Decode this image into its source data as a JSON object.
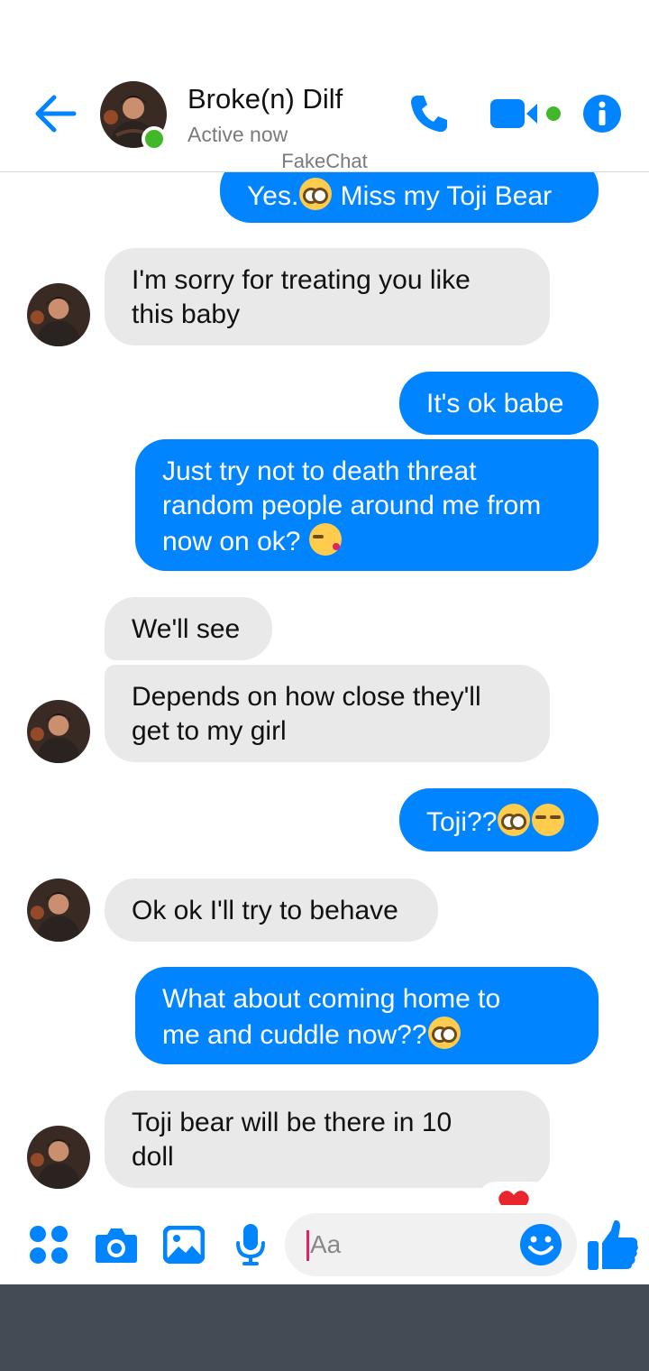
{
  "header": {
    "name": "Broke(n) Dilf",
    "status": "Active now",
    "watermark": "FakeChat"
  },
  "messages": [
    {
      "id": "m0",
      "from": "me",
      "text_before": "Yes.",
      "emoji": "flushed",
      "text_after": " Miss my Toji Bear"
    },
    {
      "id": "m1",
      "from": "them",
      "lines": [
        "I'm sorry for treating you like",
        "this baby"
      ]
    },
    {
      "id": "m2",
      "from": "me",
      "lines": [
        "It's ok babe"
      ]
    },
    {
      "id": "m3",
      "from": "me",
      "lines": [
        "Just try not to death threat",
        "random people around me from"
      ],
      "last_line": "now on ok? ",
      "emoji": "kiss"
    },
    {
      "id": "m4",
      "from": "them",
      "lines": [
        "We'll see"
      ]
    },
    {
      "id": "m5",
      "from": "them",
      "lines": [
        "Depends on how close they'll",
        "get to my girl"
      ]
    },
    {
      "id": "m6",
      "from": "me",
      "text": "Toji??",
      "emojis": [
        "flushed",
        "unamused"
      ]
    },
    {
      "id": "m7",
      "from": "them",
      "lines": [
        "Ok ok I'll try to behave"
      ]
    },
    {
      "id": "m8",
      "from": "me",
      "lines": [
        "What about coming home to"
      ],
      "last_line": "me and cuddle now??",
      "emoji": "flushed"
    },
    {
      "id": "m9",
      "from": "them",
      "lines": [
        "Toji bear will be there in 10",
        "doll"
      ],
      "reaction": "heart"
    }
  ],
  "composer": {
    "placeholder": "Aa"
  },
  "colors": {
    "accent": "#0084ff",
    "online": "#42b72a",
    "incoming_bubble": "#e9e9e9",
    "navbar": "#454b54"
  }
}
